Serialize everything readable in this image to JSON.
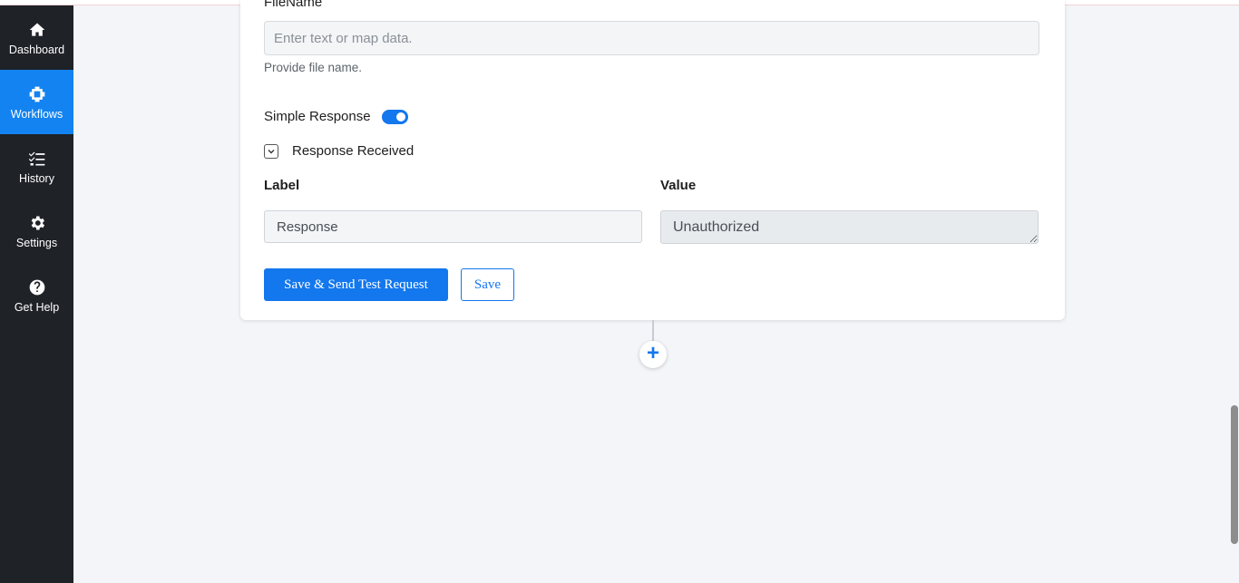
{
  "sidebar": {
    "items": [
      {
        "label": "Dashboard",
        "icon": "home-icon"
      },
      {
        "label": "Workflows",
        "icon": "workflow-icon",
        "active": true
      },
      {
        "label": "History",
        "icon": "list-check-icon"
      },
      {
        "label": "Settings",
        "icon": "gear-icon"
      },
      {
        "label": "Get Help",
        "icon": "question-circle-icon"
      }
    ]
  },
  "form": {
    "file_name_title": "FileName",
    "file_name_placeholder": "Enter text or map data.",
    "file_name_helper": "Provide file name.",
    "simple_response_label": "Simple Response",
    "simple_response_on": true,
    "response_received_label": "Response Received",
    "label_header": "Label",
    "value_header": "Value",
    "label_value": "Response",
    "value_value": "Unauthorized",
    "save_send_label": "Save & Send Test Request",
    "save_label": "Save",
    "add_step_label": "+"
  },
  "colors": {
    "accent": "#1377ee",
    "sidebar_bg": "#1f2227",
    "page_bg": "#f3f5f9"
  }
}
